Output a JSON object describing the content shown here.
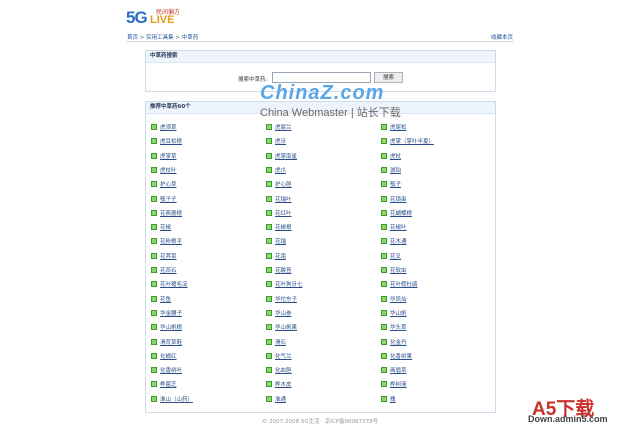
{
  "logo": {
    "five": "5G",
    "live": "LIVE",
    "tagline": "民间偏方"
  },
  "breadcrumb": {
    "home": "首页",
    "sep1": " > ",
    "tools": "实用工具集",
    "sep2": " > ",
    "current": "中草药"
  },
  "favorite_label": "收藏本页",
  "search": {
    "header": "中草药搜索",
    "label": "搜索中草药:",
    "value": "",
    "button": "搜索"
  },
  "herbs": {
    "header": "推荐中草药60个",
    "items": [
      "虎须草",
      "虎尾兰",
      "虎尾松",
      "虎耳松根",
      "虎牙",
      "虎掌（掌叶半夏）",
      "虎掌草",
      "虎掌南星",
      "虎杖",
      "虎杖叶",
      "虎爪",
      "琥珀",
      "护心草",
      "护心胆",
      "瓠子",
      "瓠子子",
      "花锚叶",
      "花锁串",
      "花燕蘑根",
      "花红叶",
      "花蝴蝶根",
      "花椒",
      "花椒根",
      "花椒叶",
      "花粉根乎",
      "花锚",
      "花木通",
      "花荠菜",
      "花南",
      "花叉",
      "花蕊石",
      "花酸苔",
      "花软虫",
      "花叶猪毛淀",
      "花叶狗牙七",
      "花叶假杜鹃",
      "花鱼",
      "华佗东子",
      "华凤仙",
      "华金腰子",
      "华山参",
      "华山帆",
      "华山帆根",
      "华山帆果",
      "华头草",
      "滑背草鞋",
      "滑石",
      "化金丹",
      "化橘红",
      "化气兰",
      "化香树果",
      "化香树叶",
      "化血胆",
      "画眉草",
      "桦菌芝",
      "桦木皮",
      "桦树液",
      "淮山（山药）",
      "淮通",
      "槐"
    ]
  },
  "footer": {
    "copyright": "© 2007-2008 5G生活 · 京ICP备06067378号"
  },
  "watermark": {
    "brand": "ChinaZ.com",
    "subtitle": "China Webmaster | 站长下载",
    "a5": "A5下载",
    "a5_domain": "Down.admin5.com"
  }
}
